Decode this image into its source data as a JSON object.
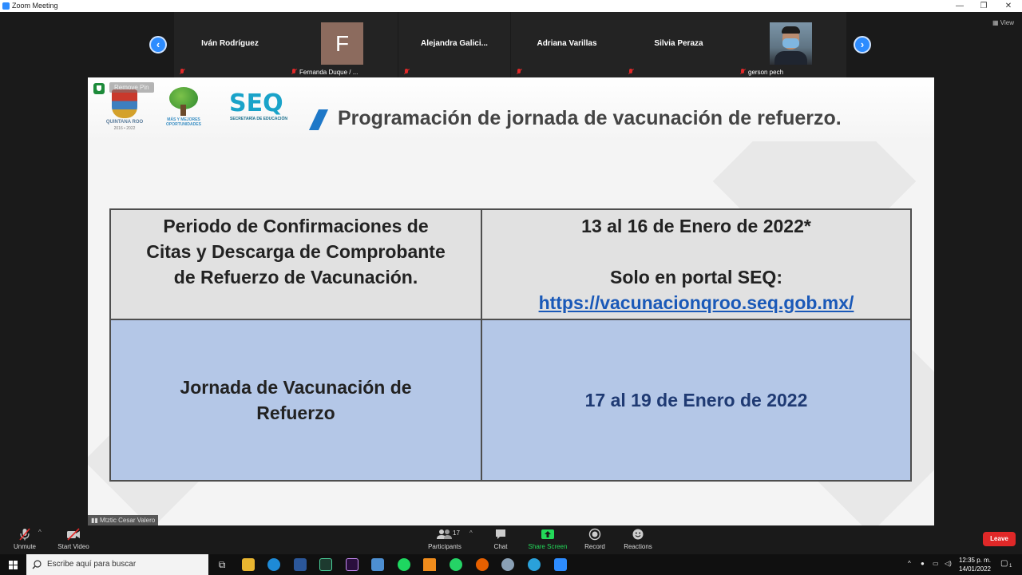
{
  "window": {
    "title": "Zoom Meeting"
  },
  "strip": {
    "view_label": "View",
    "participants": [
      {
        "name": "Iván Rodríguez",
        "style": "name"
      },
      {
        "name": "Fernanda Duque / ...",
        "style": "avatar",
        "initial": "F"
      },
      {
        "name": "Alejandra  Galici...",
        "style": "name"
      },
      {
        "name": "Adriana Varillas",
        "style": "name"
      },
      {
        "name": "Silvia Peraza",
        "style": "name"
      },
      {
        "name": "gerson pech",
        "style": "photo"
      }
    ]
  },
  "share": {
    "remove_pin": "Remove Pin",
    "logos": {
      "qroo_caption": "QUINTANA ROO",
      "qroo_years": "2016 • 2022",
      "tree_caption": "MÁS Y MEJORES OPORTUNIDADES",
      "seq_text": "SEQ",
      "seq_sub": "SECRETARÍA DE EDUCACIÓN"
    },
    "title": "Programación de jornada de vacunación de refuerzo.",
    "table": {
      "row1_label": [
        "Periodo de Confirmaciones de",
        "Citas y Descarga de Comprobante",
        "de Refuerzo de Vacunación."
      ],
      "row1_date": "13 al 16 de Enero de 2022*",
      "row1_portal": "Solo en portal SEQ:",
      "row1_link": "https://vacunacionqroo.seq.gob.mx/",
      "row2_label": [
        "Jornada de Vacunación de",
        "Refuerzo"
      ],
      "row2_date": "17 al 19 de Enero de 2022"
    },
    "speaker": "Mtztic Cesar Valero"
  },
  "controls": {
    "unmute": "Unmute",
    "start_video": "Start Video",
    "participants": "Participants",
    "participants_count": "17",
    "chat": "Chat",
    "share_screen": "Share Screen",
    "record": "Record",
    "reactions": "Reactions",
    "leave": "Leave"
  },
  "taskbar": {
    "search_placeholder": "Escribe aquí para buscar",
    "time": "12:35 p. m.",
    "date": "14/01/2022",
    "notification_count": "1"
  },
  "colors": {
    "zoom_blue": "#2d8cff",
    "share_green": "#23d959",
    "leave_red": "#e02828",
    "row2_blue": "#b4c7e7"
  }
}
